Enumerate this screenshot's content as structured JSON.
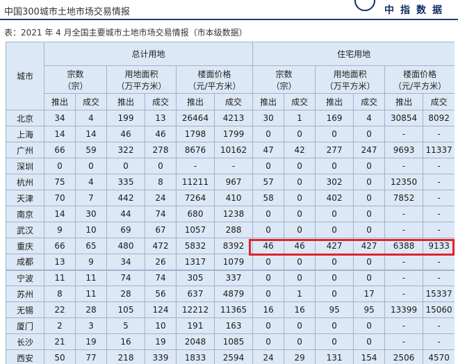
{
  "header": {
    "left_title": "中国300城市土地市场交易情报",
    "brand": "中指数据"
  },
  "caption": "表：2021 年 4 月全国主要城市土地市场交易情报（市本级数据）",
  "table": {
    "city_label": "城市",
    "group_total": "总计用地",
    "group_res": "住宅用地",
    "metrics": [
      {
        "l1": "宗数",
        "l2": "（宗）"
      },
      {
        "l1": "用地面积",
        "l2": "（万平方米）"
      },
      {
        "l1": "楼面价格",
        "l2": "（元/平方米）"
      }
    ],
    "sub": [
      "推出",
      "成交"
    ],
    "rows": [
      {
        "city": "北京",
        "v": [
          "34",
          "4",
          "199",
          "13",
          "26464",
          "4213",
          "30",
          "1",
          "169",
          "4",
          "30854",
          "8092"
        ]
      },
      {
        "city": "上海",
        "v": [
          "14",
          "14",
          "46",
          "46",
          "1798",
          "1799",
          "0",
          "0",
          "0",
          "0",
          "-",
          "-"
        ]
      },
      {
        "city": "广州",
        "v": [
          "66",
          "59",
          "322",
          "278",
          "8676",
          "10162",
          "47",
          "42",
          "277",
          "247",
          "9693",
          "11337"
        ]
      },
      {
        "city": "深圳",
        "v": [
          "0",
          "0",
          "0",
          "0",
          "-",
          "-",
          "0",
          "0",
          "0",
          "0",
          "-",
          "-"
        ]
      },
      {
        "city": "杭州",
        "v": [
          "75",
          "4",
          "335",
          "8",
          "11211",
          "967",
          "57",
          "0",
          "302",
          "0",
          "12350",
          "-"
        ]
      },
      {
        "city": "天津",
        "v": [
          "70",
          "7",
          "442",
          "24",
          "7264",
          "410",
          "58",
          "0",
          "402",
          "0",
          "7852",
          "-"
        ]
      },
      {
        "city": "南京",
        "v": [
          "14",
          "30",
          "44",
          "74",
          "680",
          "1238",
          "0",
          "0",
          "0",
          "0",
          "-",
          "-"
        ]
      },
      {
        "city": "武汉",
        "v": [
          "9",
          "10",
          "69",
          "67",
          "1057",
          "288",
          "0",
          "0",
          "0",
          "0",
          "-",
          "-"
        ]
      },
      {
        "city": "重庆",
        "v": [
          "66",
          "65",
          "480",
          "472",
          "5832",
          "8392",
          "46",
          "46",
          "427",
          "427",
          "6388",
          "9133"
        ]
      },
      {
        "city": "成都",
        "v": [
          "13",
          "9",
          "34",
          "26",
          "1317",
          "1079",
          "0",
          "0",
          "0",
          "0",
          "-",
          "-"
        ]
      },
      {
        "city": "宁波",
        "v": [
          "11",
          "11",
          "74",
          "74",
          "305",
          "337",
          "0",
          "0",
          "0",
          "0",
          "-",
          "-"
        ]
      },
      {
        "city": "苏州",
        "v": [
          "8",
          "11",
          "28",
          "56",
          "637",
          "4879",
          "0",
          "1",
          "0",
          "17",
          "-",
          "15337"
        ]
      },
      {
        "city": "无锡",
        "v": [
          "22",
          "28",
          "105",
          "124",
          "12212",
          "11365",
          "16",
          "16",
          "95",
          "95",
          "13399",
          "15060"
        ]
      },
      {
        "city": "厦门",
        "v": [
          "2",
          "3",
          "5",
          "10",
          "191",
          "163",
          "0",
          "0",
          "0",
          "0",
          "-",
          "-"
        ]
      },
      {
        "city": "长沙",
        "v": [
          "21",
          "19",
          "16",
          "19",
          "2048",
          "1085",
          "0",
          "0",
          "0",
          "0",
          "-",
          "-"
        ]
      },
      {
        "city": "西安",
        "v": [
          "50",
          "77",
          "218",
          "339",
          "1833",
          "2594",
          "24",
          "29",
          "131",
          "154",
          "2506",
          "4570"
        ]
      }
    ]
  },
  "highlight_color": "#e0242a"
}
